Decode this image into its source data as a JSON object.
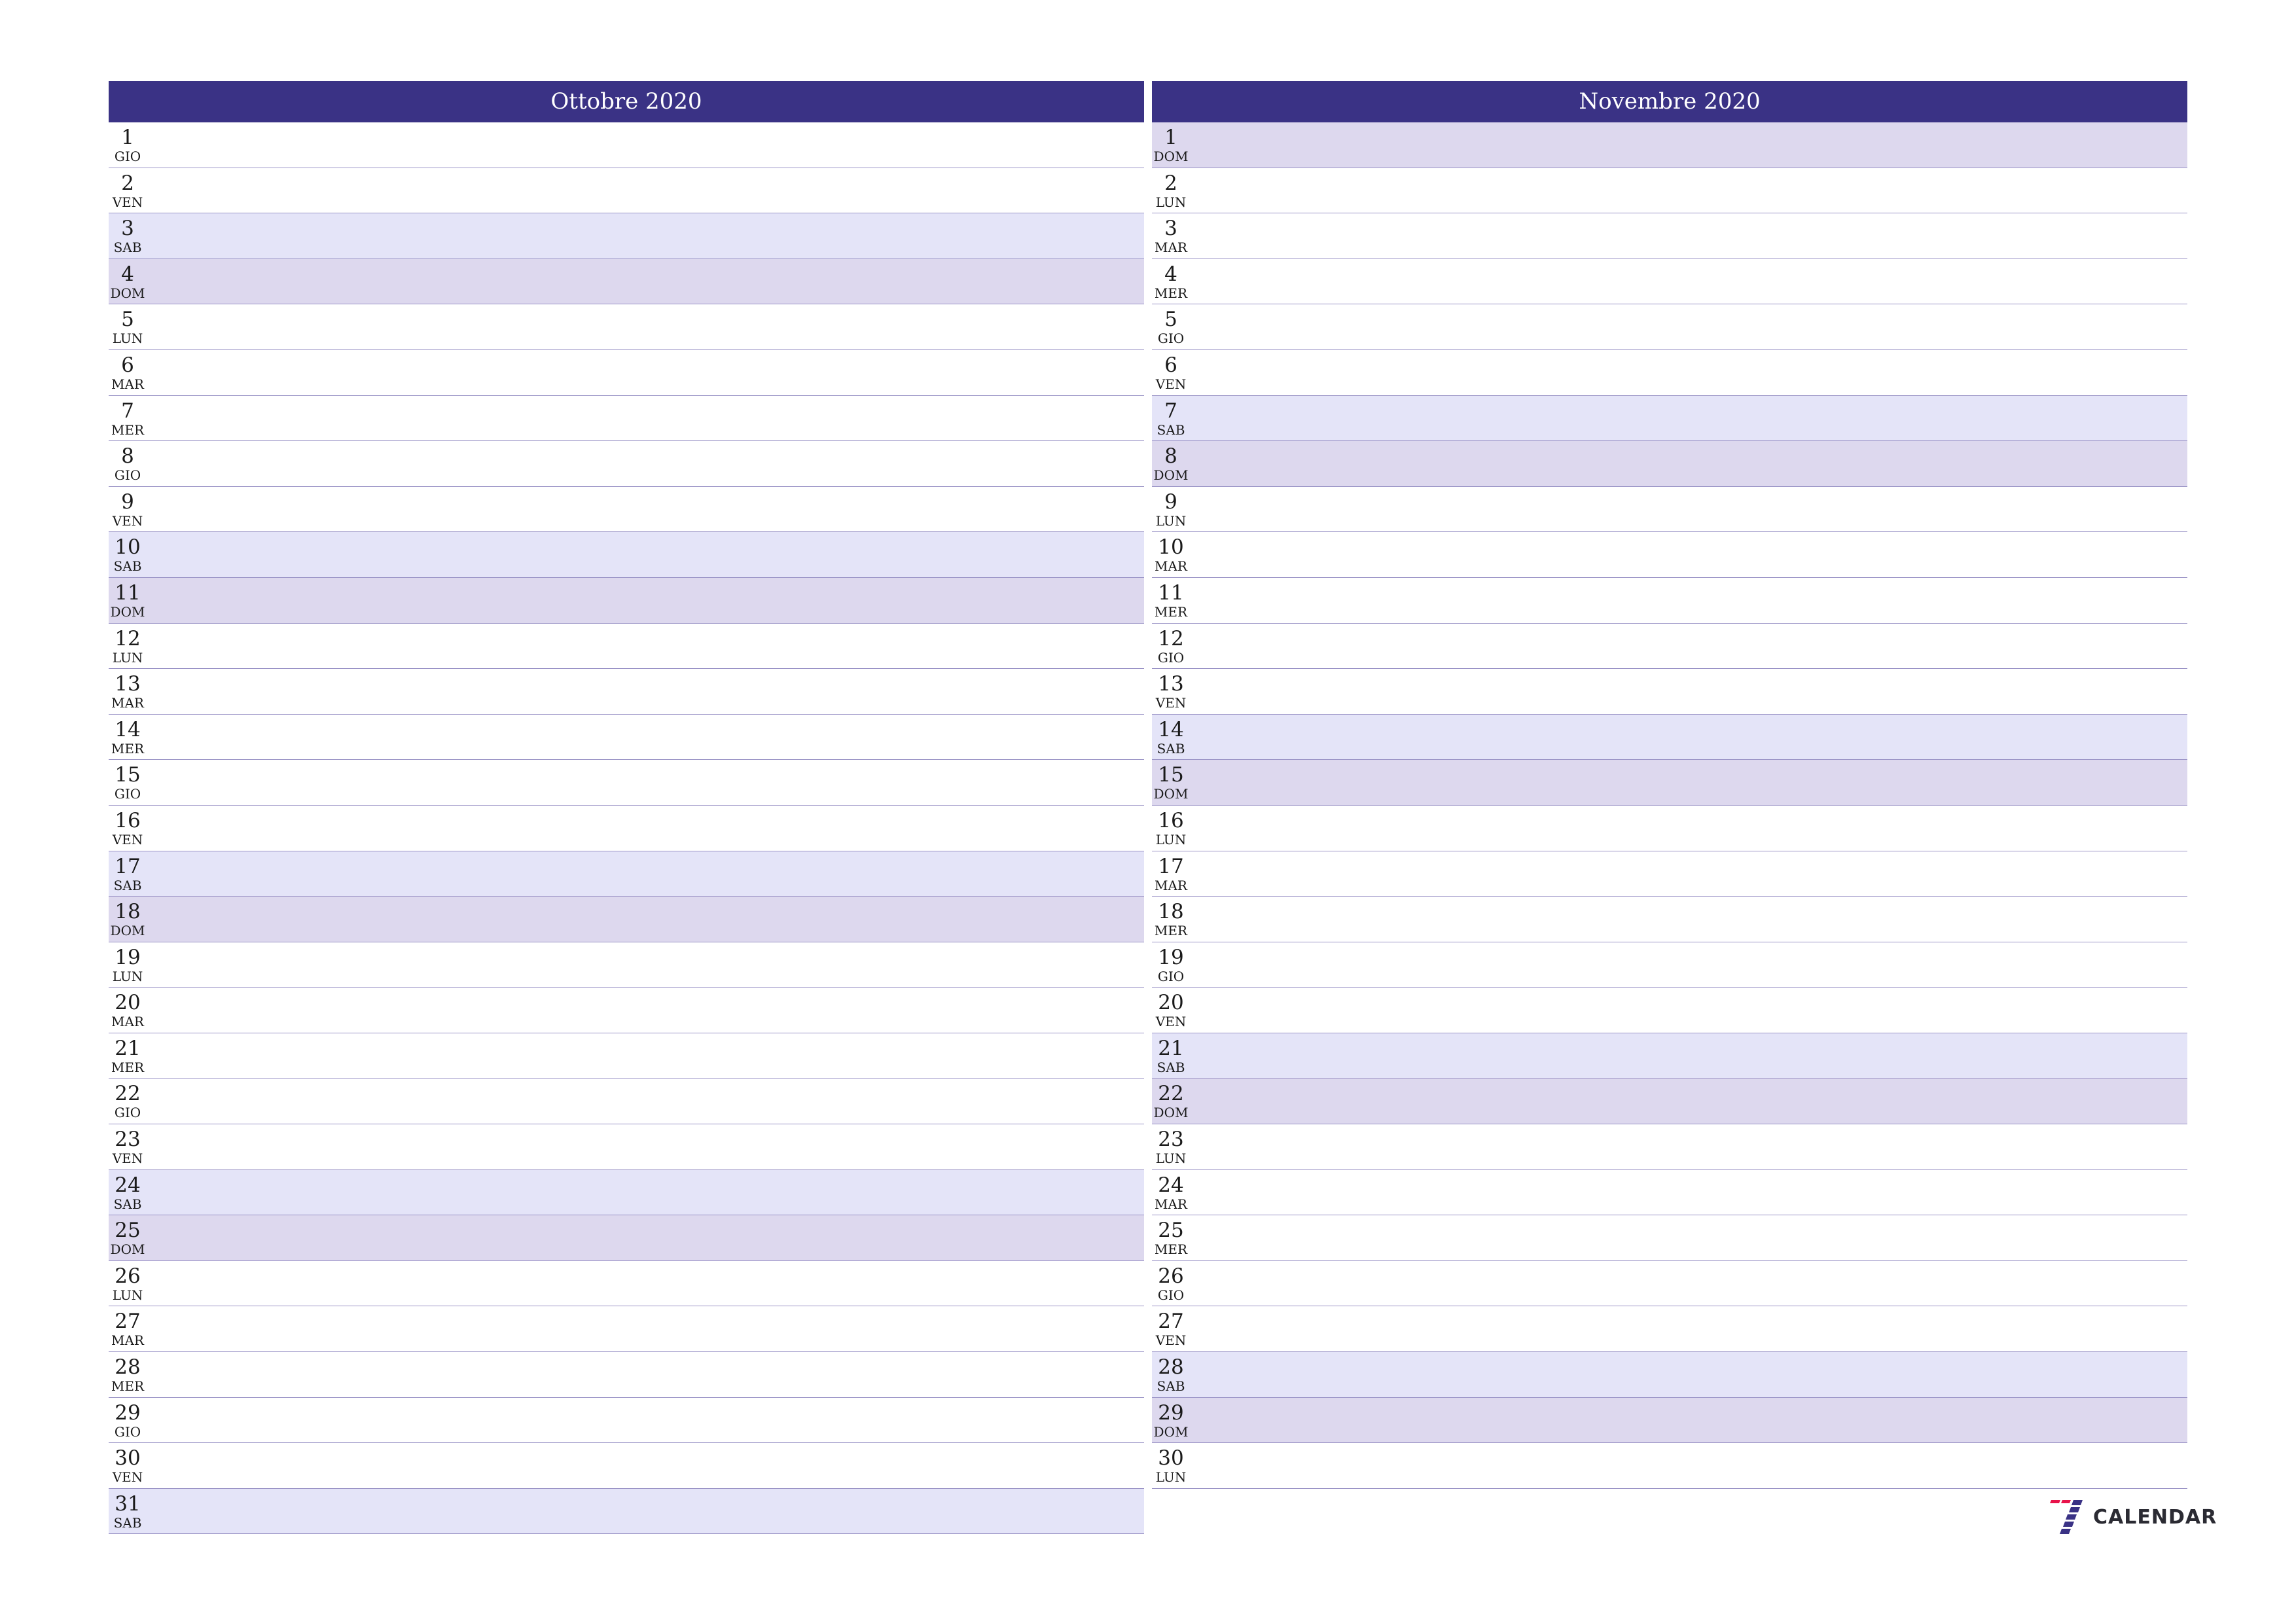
{
  "colors": {
    "header_bg": "#3a3285",
    "saturday_bg": "#e4e4f8",
    "sunday_bg": "#ddd8ee",
    "row_border": "#9a93c6",
    "logo_red": "#e8134a",
    "logo_blue": "#3a3285"
  },
  "months": [
    {
      "title": "Ottobre 2020",
      "days": [
        {
          "num": "1",
          "name": "GIO",
          "type": "weekday"
        },
        {
          "num": "2",
          "name": "VEN",
          "type": "weekday"
        },
        {
          "num": "3",
          "name": "SAB",
          "type": "sat"
        },
        {
          "num": "4",
          "name": "DOM",
          "type": "sun"
        },
        {
          "num": "5",
          "name": "LUN",
          "type": "weekday"
        },
        {
          "num": "6",
          "name": "MAR",
          "type": "weekday"
        },
        {
          "num": "7",
          "name": "MER",
          "type": "weekday"
        },
        {
          "num": "8",
          "name": "GIO",
          "type": "weekday"
        },
        {
          "num": "9",
          "name": "VEN",
          "type": "weekday"
        },
        {
          "num": "10",
          "name": "SAB",
          "type": "sat"
        },
        {
          "num": "11",
          "name": "DOM",
          "type": "sun"
        },
        {
          "num": "12",
          "name": "LUN",
          "type": "weekday"
        },
        {
          "num": "13",
          "name": "MAR",
          "type": "weekday"
        },
        {
          "num": "14",
          "name": "MER",
          "type": "weekday"
        },
        {
          "num": "15",
          "name": "GIO",
          "type": "weekday"
        },
        {
          "num": "16",
          "name": "VEN",
          "type": "weekday"
        },
        {
          "num": "17",
          "name": "SAB",
          "type": "sat"
        },
        {
          "num": "18",
          "name": "DOM",
          "type": "sun"
        },
        {
          "num": "19",
          "name": "LUN",
          "type": "weekday"
        },
        {
          "num": "20",
          "name": "MAR",
          "type": "weekday"
        },
        {
          "num": "21",
          "name": "MER",
          "type": "weekday"
        },
        {
          "num": "22",
          "name": "GIO",
          "type": "weekday"
        },
        {
          "num": "23",
          "name": "VEN",
          "type": "weekday"
        },
        {
          "num": "24",
          "name": "SAB",
          "type": "sat"
        },
        {
          "num": "25",
          "name": "DOM",
          "type": "sun"
        },
        {
          "num": "26",
          "name": "LUN",
          "type": "weekday"
        },
        {
          "num": "27",
          "name": "MAR",
          "type": "weekday"
        },
        {
          "num": "28",
          "name": "MER",
          "type": "weekday"
        },
        {
          "num": "29",
          "name": "GIO",
          "type": "weekday"
        },
        {
          "num": "30",
          "name": "VEN",
          "type": "weekday"
        },
        {
          "num": "31",
          "name": "SAB",
          "type": "sat"
        }
      ]
    },
    {
      "title": "Novembre 2020",
      "days": [
        {
          "num": "1",
          "name": "DOM",
          "type": "sun"
        },
        {
          "num": "2",
          "name": "LUN",
          "type": "weekday"
        },
        {
          "num": "3",
          "name": "MAR",
          "type": "weekday"
        },
        {
          "num": "4",
          "name": "MER",
          "type": "weekday"
        },
        {
          "num": "5",
          "name": "GIO",
          "type": "weekday"
        },
        {
          "num": "6",
          "name": "VEN",
          "type": "weekday"
        },
        {
          "num": "7",
          "name": "SAB",
          "type": "sat"
        },
        {
          "num": "8",
          "name": "DOM",
          "type": "sun"
        },
        {
          "num": "9",
          "name": "LUN",
          "type": "weekday"
        },
        {
          "num": "10",
          "name": "MAR",
          "type": "weekday"
        },
        {
          "num": "11",
          "name": "MER",
          "type": "weekday"
        },
        {
          "num": "12",
          "name": "GIO",
          "type": "weekday"
        },
        {
          "num": "13",
          "name": "VEN",
          "type": "weekday"
        },
        {
          "num": "14",
          "name": "SAB",
          "type": "sat"
        },
        {
          "num": "15",
          "name": "DOM",
          "type": "sun"
        },
        {
          "num": "16",
          "name": "LUN",
          "type": "weekday"
        },
        {
          "num": "17",
          "name": "MAR",
          "type": "weekday"
        },
        {
          "num": "18",
          "name": "MER",
          "type": "weekday"
        },
        {
          "num": "19",
          "name": "GIO",
          "type": "weekday"
        },
        {
          "num": "20",
          "name": "VEN",
          "type": "weekday"
        },
        {
          "num": "21",
          "name": "SAB",
          "type": "sat"
        },
        {
          "num": "22",
          "name": "DOM",
          "type": "sun"
        },
        {
          "num": "23",
          "name": "LUN",
          "type": "weekday"
        },
        {
          "num": "24",
          "name": "MAR",
          "type": "weekday"
        },
        {
          "num": "25",
          "name": "MER",
          "type": "weekday"
        },
        {
          "num": "26",
          "name": "GIO",
          "type": "weekday"
        },
        {
          "num": "27",
          "name": "VEN",
          "type": "weekday"
        },
        {
          "num": "28",
          "name": "SAB",
          "type": "sat"
        },
        {
          "num": "29",
          "name": "DOM",
          "type": "sun"
        },
        {
          "num": "30",
          "name": "LUN",
          "type": "weekday"
        }
      ]
    }
  ],
  "logo": {
    "icon": "seven-calendar-logo-icon",
    "text": "CALENDAR"
  }
}
